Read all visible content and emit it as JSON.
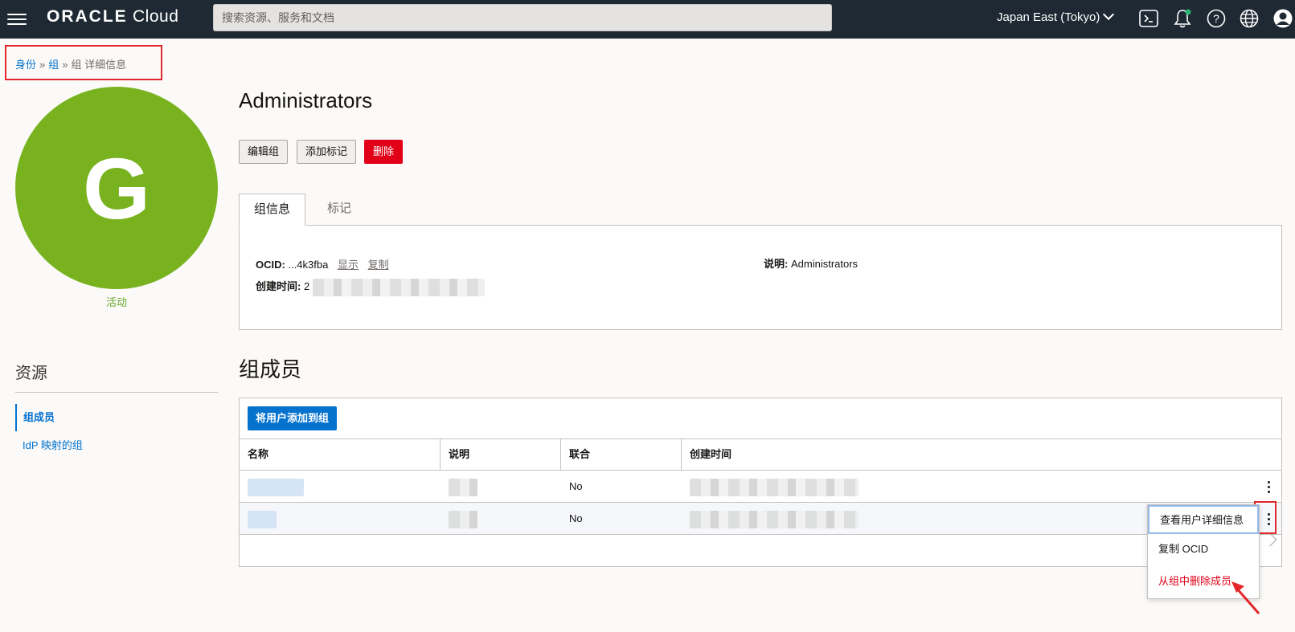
{
  "header": {
    "menu_icon": "hamburger-menu-icon",
    "logo_brand": "ORACLE",
    "logo_product": "Cloud",
    "search_placeholder": "搜索资源、服务和文档",
    "region": "Japan East (Tokyo)",
    "icons": [
      "cloud-shell-icon",
      "notifications-bell-icon",
      "help-icon",
      "language-globe-icon",
      "user-profile-icon"
    ],
    "notification_dot_color": "#2bb673"
  },
  "breadcrumb": {
    "item1": "身份",
    "item2": "组",
    "current": "组 详细信息",
    "separator": "»"
  },
  "avatar": {
    "letter": "G",
    "color": "#78b31f",
    "status": "活动"
  },
  "resources": {
    "title": "资源",
    "items": [
      "组成员",
      "IdP 映射的组"
    ],
    "active_index": 0
  },
  "group": {
    "name": "Administrators",
    "buttons": {
      "edit": "编辑组",
      "add_tag": "添加标记",
      "delete": "删除"
    },
    "tabs": [
      "组信息",
      "标记"
    ],
    "info": {
      "ocid_label": "OCID:",
      "ocid_value": "...4k3fba",
      "show_link": "显示",
      "copy_link": "复制",
      "created_label": "创建时间:",
      "created_value": "2",
      "description_label": "说明:",
      "description_value": "Administrators"
    }
  },
  "members": {
    "title": "组成员",
    "add_button": "将用户添加到组",
    "columns": [
      "名称",
      "说明",
      "联合",
      "创建时间"
    ],
    "rows": [
      {
        "name": "",
        "description": "",
        "federated": "No",
        "created": ""
      },
      {
        "name": "",
        "description": "",
        "federated": "No",
        "created": ""
      }
    ]
  },
  "context_menu": {
    "items": [
      "查看用户详细信息",
      "复制 OCID",
      "从组中删除成员"
    ]
  },
  "colors": {
    "header_bg": "#1e2933",
    "link": "#0572ce",
    "danger": "#e10017",
    "annotation": "#e3272b",
    "avatar_green": "#78b31f"
  }
}
